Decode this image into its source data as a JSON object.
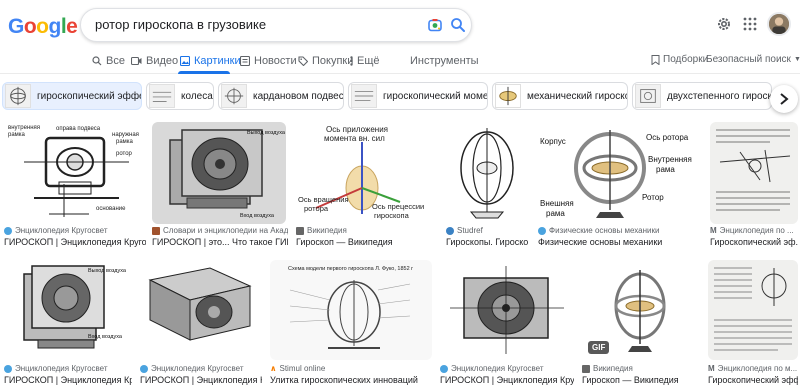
{
  "logo": {
    "text": "Google",
    "letters": [
      "G",
      "o",
      "o",
      "g",
      "l",
      "e"
    ],
    "colors": [
      "#4285f4",
      "#ea4335",
      "#fbbc05",
      "#4285f4",
      "#34a853",
      "#ea4335"
    ]
  },
  "search": {
    "query": "ротор гироскопа в грузовике"
  },
  "tabs": [
    {
      "label": "Все",
      "icon": "search-icon"
    },
    {
      "label": "Видео",
      "icon": "video-icon"
    },
    {
      "label": "Картинки",
      "icon": "image-icon",
      "active": true
    },
    {
      "label": "Новости",
      "icon": "news-icon"
    },
    {
      "label": "Покупки",
      "icon": "tag-icon"
    },
    {
      "label": "Ещё",
      "icon": "more-icon"
    }
  ],
  "tools_label": "Инструменты",
  "right_tools": {
    "collections": "Подборки",
    "safesearch": "Безопасный поиск"
  },
  "chips": [
    {
      "label": "гироскопический эффект",
      "selected": true
    },
    {
      "label": "колеса"
    },
    {
      "label": "кардановом подвесе"
    },
    {
      "label": "гироскопический момент"
    },
    {
      "label": "механический гироскоп"
    },
    {
      "label": "двухстепенного гироскопа"
    }
  ],
  "row1": [
    {
      "source": "Энциклопедия Кругосвет",
      "caption": "ГИРОСКОП | Энциклопедия Кругосвет",
      "fav": "#4aa3df",
      "labels": [
        "внутренняя",
        "рамка",
        "оправа подвеса",
        "наружная",
        "рамка",
        "ротор",
        "основание"
      ]
    },
    {
      "source": "Словари и энциклопедии на Акад...",
      "caption": "ГИРОСКОП | это... Что такое ГИРОСК...",
      "fav": "#a0522d",
      "labels": [
        "Выход воздуха",
        "Вход воздуха"
      ]
    },
    {
      "source": "Википедия",
      "caption": "Гироскоп — Википедия",
      "fav": "#666666",
      "labels": [
        "Ось приложения",
        "момента вн. сил",
        "Ось вращения",
        "ротора",
        "Ось прецессии",
        "гироскопа"
      ]
    },
    {
      "source": "Studref",
      "caption": "Гироскопы. Гироскопические...",
      "fav": "#3b82c4",
      "labels": []
    },
    {
      "source": "Физические основы механики",
      "caption": "Физические основы механики",
      "fav": "#4aa3df",
      "labels": [
        "Корпус",
        "Ось ротора",
        "Внутренняя",
        "рама",
        "Внешняя",
        "рама",
        "Ротор"
      ]
    },
    {
      "source": "Энциклопедия по ...",
      "caption": "Гироскопический эф...",
      "fav": "#666666",
      "labels": []
    }
  ],
  "row2": [
    {
      "source": "Энциклопедия Кругосвет",
      "caption": "ГИРОСКОП | Энциклопедия Кругосвет",
      "fav": "#4aa3df",
      "labels": [
        "Выход воздуха",
        "Вход воздуха"
      ]
    },
    {
      "source": "Энциклопедия Кругосвет",
      "caption": "ГИРОСКОП | Энциклопедия Кругосвет",
      "fav": "#4aa3df",
      "labels": []
    },
    {
      "source": "Stimul online",
      "caption": "Улитка гироскопических инноваций",
      "fav": "#f57c00",
      "labels": [
        "Схема модели первого гироскопа Л. Фуко, 1852 г"
      ]
    },
    {
      "source": "Энциклопедия Кругосвет",
      "caption": "ГИРОСКОП | Энциклопедия Кругосвет",
      "fav": "#4aa3df",
      "labels": []
    },
    {
      "source": "Википедия",
      "caption": "Гироскоп — Википедия",
      "fav": "#666666",
      "labels": [],
      "badge": "GIF"
    },
    {
      "source": "Энциклопедия по м...",
      "caption": "Гироскопический эфф...",
      "fav": "#666666",
      "labels": []
    }
  ]
}
